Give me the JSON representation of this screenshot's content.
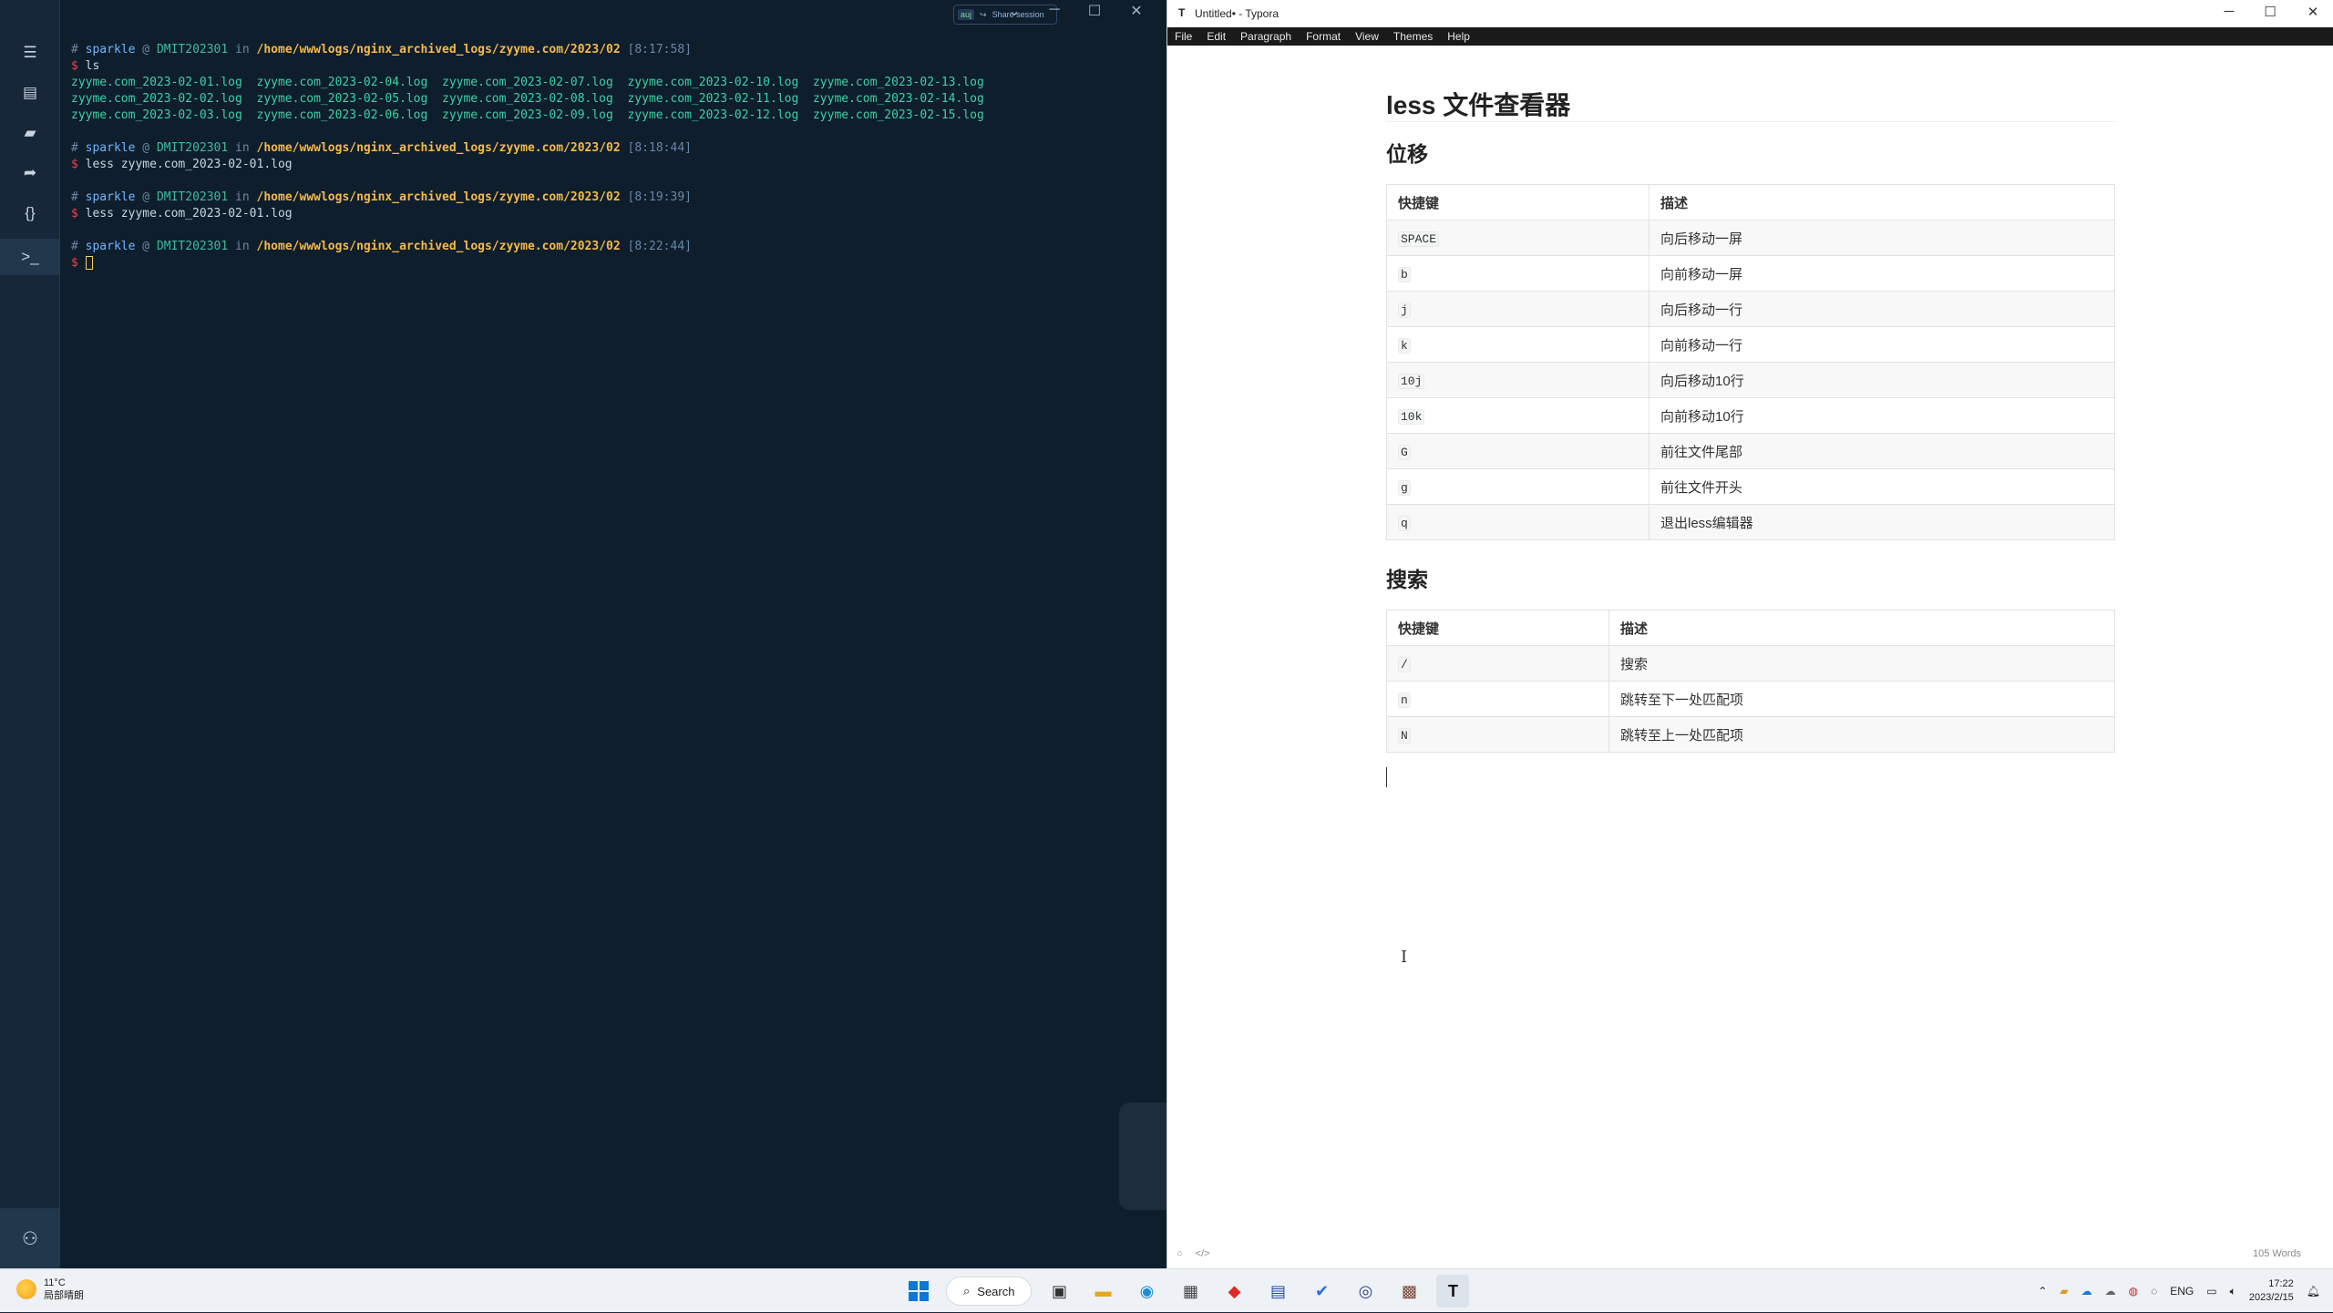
{
  "terminal": {
    "share": {
      "badge": "auj",
      "label": "Share session"
    },
    "prompts": [
      {
        "user": "sparkle",
        "host": "DMIT202301",
        "path": "/home/wwwlogs/nginx_archived_logs/zyyme.com/2023/02",
        "time": "[8:17:58]",
        "command": "ls"
      },
      {
        "user": "sparkle",
        "host": "DMIT202301",
        "path": "/home/wwwlogs/nginx_archived_logs/zyyme.com/2023/02",
        "time": "[8:18:44]",
        "command": "less zyyme.com_2023-02-01.log"
      },
      {
        "user": "sparkle",
        "host": "DMIT202301",
        "path": "/home/wwwlogs/nginx_archived_logs/zyyme.com/2023/02",
        "time": "[8:19:39]",
        "command": "less zyyme.com_2023-02-01.log"
      },
      {
        "user": "sparkle",
        "host": "DMIT202301",
        "path": "/home/wwwlogs/nginx_archived_logs/zyyme.com/2023/02",
        "time": "[8:22:44]",
        "command": ""
      }
    ],
    "ls_output": [
      "zyyme.com_2023-02-01.log  zyyme.com_2023-02-04.log  zyyme.com_2023-02-07.log  zyyme.com_2023-02-10.log  zyyme.com_2023-02-13.log",
      "zyyme.com_2023-02-02.log  zyyme.com_2023-02-05.log  zyyme.com_2023-02-08.log  zyyme.com_2023-02-11.log  zyyme.com_2023-02-14.log",
      "zyyme.com_2023-02-03.log  zyyme.com_2023-02-06.log  zyyme.com_2023-02-09.log  zyyme.com_2023-02-12.log  zyyme.com_2023-02-15.log"
    ],
    "sym": {
      "hash": "#",
      "at": "@",
      "in": "in",
      "dollar": "$"
    }
  },
  "typora": {
    "window_title": "Untitled• - Typora",
    "menu": [
      "File",
      "Edit",
      "Paragraph",
      "Format",
      "View",
      "Themes",
      "Help"
    ],
    "h1": "less 文件查看器",
    "section1": {
      "heading": "位移",
      "headers": [
        "快捷键",
        "描述"
      ],
      "rows": [
        [
          "SPACE",
          "向后移动一屏"
        ],
        [
          "b",
          "向前移动一屏"
        ],
        [
          "j",
          "向后移动一行"
        ],
        [
          "k",
          "向前移动一行"
        ],
        [
          "10j",
          "向后移动10行"
        ],
        [
          "10k",
          "向前移动10行"
        ],
        [
          "G",
          "前往文件尾部"
        ],
        [
          "g",
          "前往文件开头"
        ],
        [
          "q",
          "退出less编辑器"
        ]
      ]
    },
    "section2": {
      "heading": "搜索",
      "headers": [
        "快捷键",
        "描述"
      ],
      "rows": [
        [
          "/",
          "搜索"
        ],
        [
          "n",
          "跳转至下一处匹配项"
        ],
        [
          "N",
          "跳转至上一处匹配项"
        ]
      ]
    },
    "word_count": "105 Words"
  },
  "taskbar": {
    "weather_temp": "11°C",
    "weather_desc": "局部晴朗",
    "search_label": "Search",
    "lang": "ENG",
    "time": "17:22",
    "date": "2023/2/15"
  }
}
